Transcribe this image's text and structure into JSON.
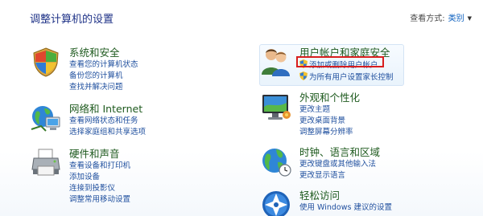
{
  "header": {
    "title": "调整计算机的设置",
    "view_by_label": "查看方式:",
    "view_by_value": "类别"
  },
  "categories": {
    "system": {
      "title": "系统和安全",
      "icon": "shield-flag-icon",
      "links": [
        "查看您的计算机状态",
        "备份您的计算机",
        "查找并解决问题"
      ]
    },
    "network": {
      "title": "网络和 Internet",
      "icon": "network-globe-icon",
      "links": [
        "查看网络状态和任务",
        "选择家庭组和共享选项"
      ]
    },
    "hardware": {
      "title": "硬件和声音",
      "icon": "printer-icon",
      "links": [
        "查看设备和打印机",
        "添加设备",
        "连接到投影仪",
        "调整常用移动设置"
      ]
    },
    "users": {
      "title": "用户帐户和家庭安全",
      "icon": "users-icon",
      "links": [
        "添加或删除用户帐户",
        "为所有用户设置家长控制"
      ]
    },
    "appearance": {
      "title": "外观和个性化",
      "icon": "monitor-icon",
      "links": [
        "更改主题",
        "更改桌面背景",
        "调整屏幕分辨率"
      ]
    },
    "clock": {
      "title": "时钟、语言和区域",
      "icon": "globe-clock-icon",
      "links": [
        "更改键盘或其他输入法",
        "更改显示语言"
      ]
    },
    "ease": {
      "title": "轻松访问",
      "icon": "ease-of-access-icon",
      "links": [
        "使用 Windows 建议的设置"
      ]
    }
  },
  "colors": {
    "heading": "#1e5a1e",
    "link": "#1f4f9e",
    "highlight": "#d81e1e"
  }
}
